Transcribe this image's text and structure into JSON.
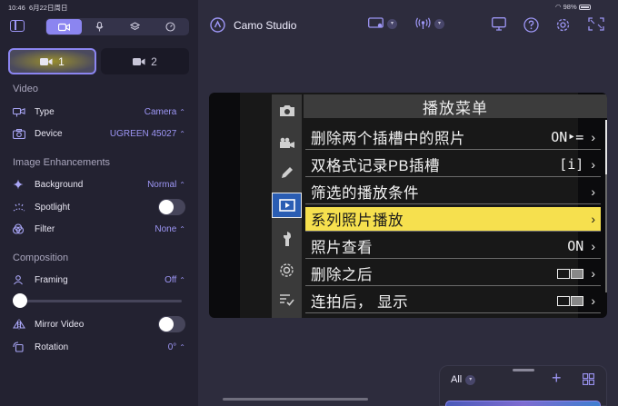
{
  "status": {
    "time": "10:46",
    "date": "6月22日周日",
    "battery": "98%"
  },
  "sidebar": {
    "mode_tabs": [
      {
        "name": "video-camera-icon",
        "active": true
      },
      {
        "name": "microphone-icon",
        "active": false
      },
      {
        "name": "layers-icon",
        "active": false
      },
      {
        "name": "gauge-icon",
        "active": false
      }
    ],
    "cameras": [
      {
        "label": "1",
        "active": true
      },
      {
        "label": "2",
        "active": false
      }
    ],
    "video": {
      "title": "Video",
      "type_label": "Type",
      "type_value": "Camera",
      "device_label": "Device",
      "device_value": "UGREEN 45027"
    },
    "enhancements": {
      "title": "Image Enhancements",
      "background_label": "Background",
      "background_value": "Normal",
      "spotlight_label": "Spotlight",
      "spotlight_on": false,
      "filter_label": "Filter",
      "filter_value": "None"
    },
    "composition": {
      "title": "Composition",
      "framing_label": "Framing",
      "framing_value": "Off",
      "framing_slider": 0,
      "mirror_label": "Mirror Video",
      "mirror_on": false,
      "rotation_label": "Rotation",
      "rotation_value": "0°"
    }
  },
  "header": {
    "title": "Camo Studio"
  },
  "camera_menu": {
    "title": "播放菜单",
    "items": [
      {
        "label": "删除两个插槽中的照片",
        "value": "ON‣=",
        "highlight": false
      },
      {
        "label": "双格式记录PB插槽",
        "value": "[i]",
        "highlight": false
      },
      {
        "label": "筛选的播放条件",
        "value": "",
        "highlight": false
      },
      {
        "label": "系列照片播放",
        "value": "",
        "highlight": true
      },
      {
        "label": "照片查看",
        "value": "ON",
        "highlight": false
      },
      {
        "label": "删除之后",
        "value": "",
        "highlight": false
      },
      {
        "label": "连拍后， 显示",
        "value": "",
        "highlight": false
      }
    ]
  },
  "scenes_panel": {
    "filter_label": "All"
  },
  "colors": {
    "accent": "#8b85f0",
    "highlight": "#f6e04e",
    "sidebar_bg": "#232231"
  }
}
